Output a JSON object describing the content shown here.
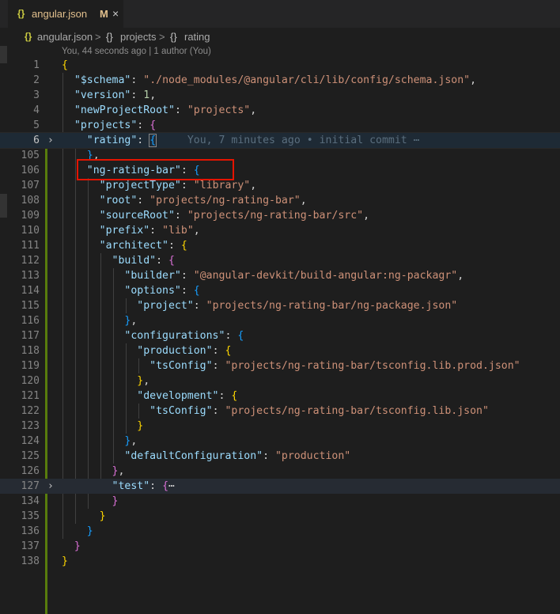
{
  "tab": {
    "icon": "json-braces-icon",
    "name": "angular.json",
    "status": "M",
    "close": "×"
  },
  "breadcrumb": {
    "items": [
      {
        "icon": "{}",
        "label": "angular.json"
      },
      {
        "icon": "{}",
        "label": "projects"
      },
      {
        "icon": "{}",
        "label": "rating"
      }
    ],
    "separator": ">"
  },
  "blame_header": "You, 44 seconds ago | 1 author (You)",
  "inline_blame": "You, 7 minutes ago • initial commit ⋯",
  "lines": [
    {
      "num": "1"
    },
    {
      "num": "2"
    },
    {
      "num": "3"
    },
    {
      "num": "4"
    },
    {
      "num": "5"
    },
    {
      "num": "6"
    },
    {
      "num": "105"
    },
    {
      "num": "106"
    },
    {
      "num": "107"
    },
    {
      "num": "108"
    },
    {
      "num": "109"
    },
    {
      "num": "110"
    },
    {
      "num": "111"
    },
    {
      "num": "112"
    },
    {
      "num": "113"
    },
    {
      "num": "114"
    },
    {
      "num": "115"
    },
    {
      "num": "116"
    },
    {
      "num": "117"
    },
    {
      "num": "118"
    },
    {
      "num": "119"
    },
    {
      "num": "120"
    },
    {
      "num": "121"
    },
    {
      "num": "122"
    },
    {
      "num": "123"
    },
    {
      "num": "124"
    },
    {
      "num": "125"
    },
    {
      "num": "126"
    },
    {
      "num": "127"
    },
    {
      "num": "134"
    },
    {
      "num": "135"
    },
    {
      "num": "136"
    },
    {
      "num": "137"
    },
    {
      "num": "138"
    }
  ],
  "json": {
    "schema_key": "\"$schema\"",
    "schema_val": "\"./node_modules/@angular/cli/lib/config/schema.json\"",
    "version_key": "\"version\"",
    "version_val": "1",
    "npr_key": "\"newProjectRoot\"",
    "npr_val": "\"projects\"",
    "projects_key": "\"projects\"",
    "rating_key": "\"rating\"",
    "ngrb_key": "\"ng-rating-bar\"",
    "ptype_key": "\"projectType\"",
    "ptype_val": "\"library\"",
    "root_key": "\"root\"",
    "root_val": "\"projects/ng-rating-bar\"",
    "sroot_key": "\"sourceRoot\"",
    "sroot_val": "\"projects/ng-rating-bar/src\"",
    "prefix_key": "\"prefix\"",
    "prefix_val": "\"lib\"",
    "architect_key": "\"architect\"",
    "build_key": "\"build\"",
    "builder_key": "\"builder\"",
    "builder_val": "\"@angular-devkit/build-angular:ng-packagr\"",
    "options_key": "\"options\"",
    "project_key": "\"project\"",
    "project_val": "\"projects/ng-rating-bar/ng-package.json\"",
    "configs_key": "\"configurations\"",
    "prod_key": "\"production\"",
    "tsconfig_key": "\"tsConfig\"",
    "prod_ts_val": "\"projects/ng-rating-bar/tsconfig.lib.prod.json\"",
    "dev_key": "\"development\"",
    "dev_ts_val": "\"projects/ng-rating-bar/tsconfig.lib.json\"",
    "defconf_key": "\"defaultConfiguration\"",
    "defconf_val": "\"production\"",
    "test_key": "\"test\"",
    "ellipsis": "⋯"
  },
  "colors": {
    "key": "#9cdcfe",
    "string": "#ce9178",
    "number": "#b5cea8",
    "highlight_box": "#e51400",
    "git_added": "#587c0c"
  }
}
